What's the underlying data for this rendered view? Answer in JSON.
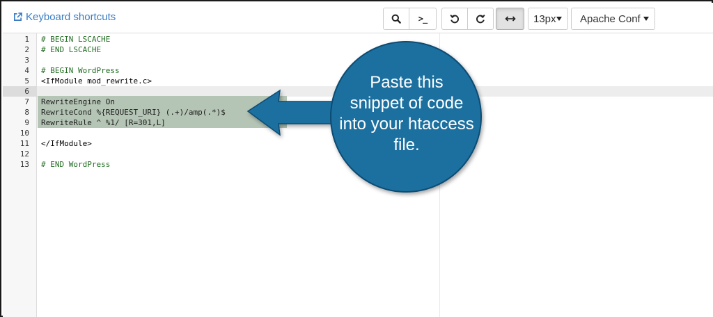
{
  "toolbar": {
    "keyboard_shortcuts": "Keyboard shortcuts",
    "buttons": {
      "search": "search-icon",
      "terminal": ">_",
      "undo": "undo-icon",
      "redo": "redo-icon",
      "wrap": "wrap-toggle-icon"
    },
    "font_size": {
      "selected": "13px"
    },
    "mode": {
      "selected": "Apache Conf"
    }
  },
  "editor": {
    "active_line": 6,
    "selected_lines": [
      7,
      8,
      9
    ],
    "lines": [
      {
        "num": "1",
        "text": "# BEGIN LSCACHE"
      },
      {
        "num": "2",
        "text": "# END LSCACHE"
      },
      {
        "num": "3",
        "text": ""
      },
      {
        "num": "4",
        "text": "# BEGIN WordPress"
      },
      {
        "num": "5",
        "text": "<IfModule mod_rewrite.c>"
      },
      {
        "num": "6",
        "text": ""
      },
      {
        "num": "7",
        "text": "RewriteEngine On"
      },
      {
        "num": "8",
        "text": "RewriteCond %{REQUEST_URI} (.+)/amp(.*)$"
      },
      {
        "num": "9",
        "text": "RewriteRule ^ %1/ [R=301,L]"
      },
      {
        "num": "10",
        "text": ""
      },
      {
        "num": "11",
        "text": "</IfModule>"
      },
      {
        "num": "12",
        "text": ""
      },
      {
        "num": "13",
        "text": "# END WordPress"
      }
    ]
  },
  "annotation": {
    "text_lines": [
      "Paste this",
      "snippet of code",
      "into your htaccess",
      "file."
    ],
    "circle_color": "#1a6fa0",
    "circle_border": "#0c4c73"
  },
  "colors": {
    "link": "#3a7cc1",
    "selection": "#b5c5b5",
    "comment": "#236e24"
  }
}
